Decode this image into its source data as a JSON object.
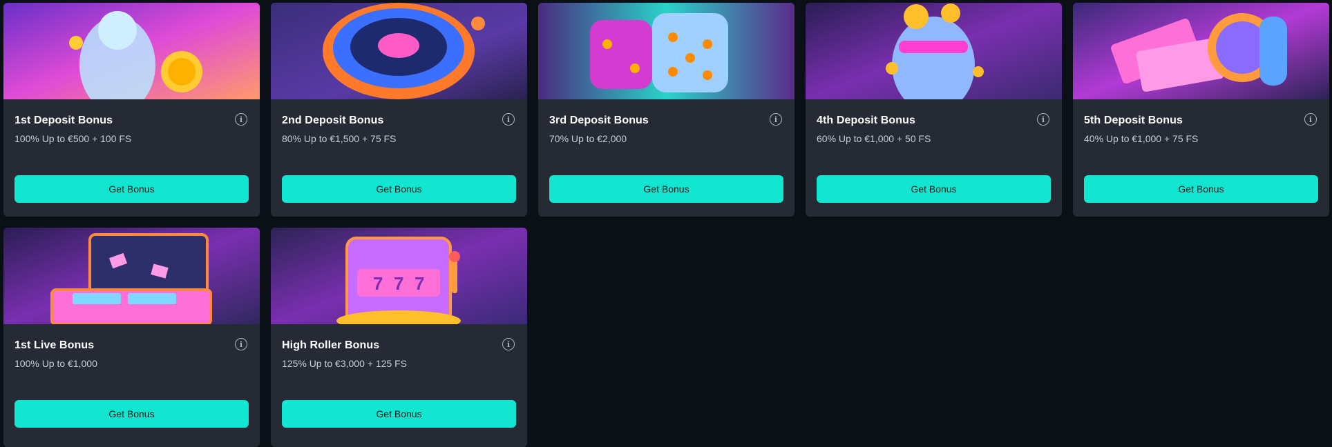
{
  "bonuses": [
    {
      "title": "1st Deposit Bonus",
      "subtitle": "100% Up to €500 + 100 FS",
      "button": "Get Bonus",
      "image": "statue-with-gold-coin"
    },
    {
      "title": "2nd Deposit Bonus",
      "subtitle": "80% Up to €1,500 + 75 FS",
      "button": "Get Bonus",
      "image": "neon-roulette-wheel"
    },
    {
      "title": "3rd Deposit Bonus",
      "subtitle": "70% Up to €2,000",
      "button": "Get Bonus",
      "image": "glowing-dice"
    },
    {
      "title": "4th Deposit Bonus",
      "subtitle": "60% Up to €1,000 + 50 FS",
      "button": "Get Bonus",
      "image": "statue-head-with-coins"
    },
    {
      "title": "5th Deposit Bonus",
      "subtitle": "40% Up to €1,000 + 75 FS",
      "button": "Get Bonus",
      "image": "hand-with-cash-and-coin"
    },
    {
      "title": "1st Live Bonus",
      "subtitle": "100% Up to €1,000",
      "button": "Get Bonus",
      "image": "suitcase-of-cash"
    },
    {
      "title": "High Roller Bonus",
      "subtitle": "125% Up to €3,000 + 125 FS",
      "button": "Get Bonus",
      "image": "slot-machine-777"
    }
  ],
  "info_icon": "info-icon",
  "colors": {
    "page_bg": "#0b0f16",
    "card_bg": "#252a35",
    "button_bg": "#12e6d0",
    "button_text": "#0b1a1c"
  }
}
